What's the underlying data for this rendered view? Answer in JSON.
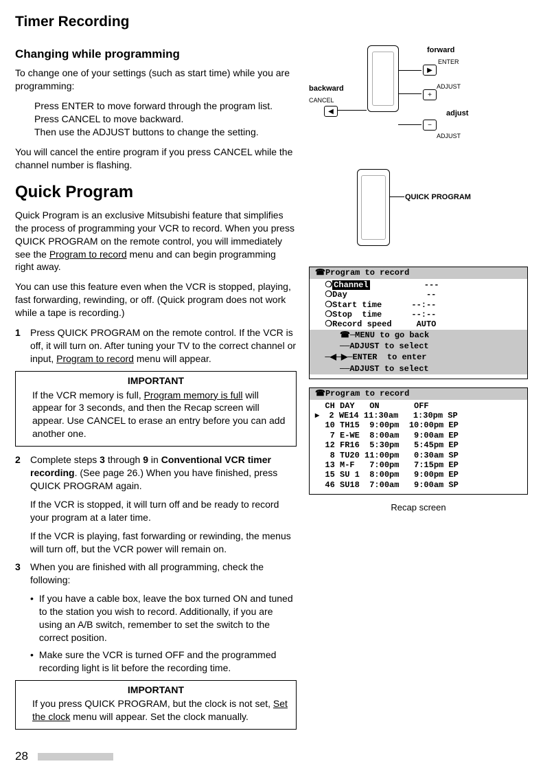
{
  "title": "Timer Recording",
  "sub1": {
    "heading": "Changing while programming",
    "intro": "To change one of your settings (such as start time) while you are programming:",
    "steps": [
      "Press ENTER to move forward through the program list.",
      "Press CANCEL to move backward.",
      "Then use the ADJUST buttons to change the setting."
    ],
    "note": "You will cancel the entire program if you press CANCEL while the channel number is flashing."
  },
  "quick": {
    "heading": "Quick Program",
    "p1_a": "Quick Program is an exclusive Mitsubishi feature that simplifies the process of programming your VCR to record.  When you press QUICK PROGRAM on the remote control, you will immediately see the ",
    "p1_link": "Program to record",
    "p1_b": " menu and can begin programming right away.",
    "p2": "You can use this feature even when the VCR is stopped, playing, fast forwarding, rewinding, or off.  (Quick program does not work while a tape is recording.)",
    "step1a": "Press QUICK PROGRAM on the remote control.  If the VCR is off, it will turn on.  After tuning your TV to the correct channel or input, ",
    "step1link": "Program to record",
    "step1b": " menu will appear.",
    "important1_title": "IMPORTANT",
    "important1_a": "If the VCR memory is full, ",
    "important1_link": "Program memory is full",
    "important1_b": " will appear for 3 seconds, and then the Recap screen will appear.  Use CANCEL to erase an entry before you can add another one.",
    "step2a": "Complete steps ",
    "step2b3": "3",
    "step2c": " through ",
    "step2b9": "9",
    "step2d": " in ",
    "step2bold": "Conventional VCR timer recording",
    "step2e": ".  (See page 26.)  When you have finished, press QUICK PROGRAM again.",
    "step2sub1": "If the VCR is stopped, it will turn off and be ready to record your program at a later time.",
    "step2sub2": "If the VCR is playing, fast forwarding or rewinding, the menus will turn off, but the VCR power will remain on.",
    "step3": "When you are finished with all programming, check the following:",
    "bullets": [
      "If you have a cable box, leave the box turned ON and tuned to the station you wish to record.  Additionally, if you are using an A/B switch, remember to set the switch to the correct position.",
      "Make sure the VCR is turned OFF and the programmed recording light is lit before the recording time."
    ],
    "important2_title": "IMPORTANT",
    "important2_a": "If you press QUICK PROGRAM, but the clock is not set, ",
    "important2_link": "Set the clock",
    "important2_b": " menu will appear.  Set the clock manually."
  },
  "diagram1": {
    "backward": "backward",
    "forward": "forward",
    "enter": "ENTER",
    "cancel": "CANCEL",
    "adjust": "ADJUST",
    "adjust_bold": "adjust"
  },
  "diagram2": {
    "label": "QUICK PROGRAM"
  },
  "screen1": {
    "title": "☎Program to record",
    "l1a": "  ❍",
    "l1h": "Channel",
    "l1b": "           ---",
    "l2": "  ❍Day                --",
    "l3": "  ❍Start time      --:--",
    "l4": "  ❍Stop  time      --:--",
    "l5": "  ❍Record speed     AUTO",
    "i1": "     ☎─MENU to go back",
    "i2": "     ──ADJUST to select",
    "i3": "  ─◀─▶─ENTER  to enter",
    "i4": "     ──ADJUST to select"
  },
  "screen2": {
    "title": "☎Program to record",
    "header": "  CH DAY   ON       OFF",
    "rows": [
      "▸  2 WE14 11:30am   1:30pm SP",
      "  10 TH15  9:00pm  10:00pm EP",
      "   7 E-WE  8:00am   9:00am EP",
      "  12 FR16  5:30pm   5:45pm EP",
      "   8 TU20 11:00pm   0:30am SP",
      "  13 M-F   7:00pm   7:15pm EP",
      "  15 SU 1  8:00pm   9:00pm EP",
      "  46 SU18  7:00am   9:00am SP"
    ],
    "caption": "Recap screen"
  },
  "page_number": "28"
}
